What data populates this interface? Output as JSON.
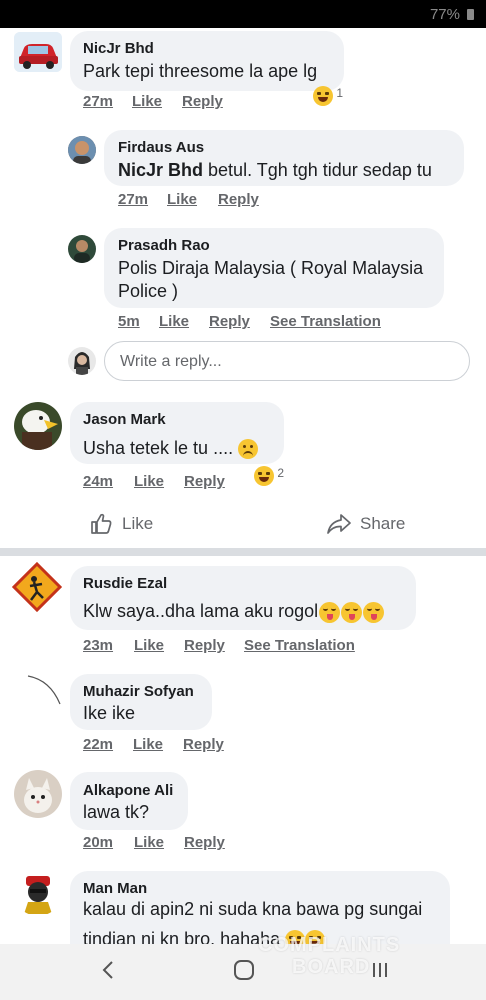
{
  "status_bar": {
    "battery": "77%"
  },
  "comments": [
    {
      "name": "NicJr Bhd",
      "text": "Park tepi threesome la ape lg",
      "time": "27m",
      "like": "Like",
      "reply": "Reply",
      "reaction_count": "1"
    },
    {
      "name": "Firdaus Aus",
      "mention": "NicJr Bhd",
      "text": " betul. Tgh tgh tidur sedap tu",
      "time": "27m",
      "like": "Like",
      "reply": "Reply"
    },
    {
      "name": "Prasadh Rao",
      "text_line1": "Polis Diraja Malaysia ( Royal Malaysia",
      "text_line2": "Police )",
      "time": "5m",
      "like": "Like",
      "reply": "Reply",
      "translate": "See Translation"
    },
    {
      "name": "Jason Mark",
      "text": "Usha tetek le tu .... ",
      "time": "24m",
      "like": "Like",
      "reply": "Reply",
      "reaction_count": "2"
    },
    {
      "name": "Rusdie Ezal",
      "text": "Klw saya..dha lama aku rogol",
      "time": "23m",
      "like": "Like",
      "reply": "Reply",
      "translate": "See Translation"
    },
    {
      "name": "Muhazir Sofyan",
      "text": "Ike ike",
      "time": "22m",
      "like": "Like",
      "reply": "Reply"
    },
    {
      "name": "Alkapone Ali",
      "text": "lawa  tk?",
      "time": "20m",
      "like": "Like",
      "reply": "Reply"
    },
    {
      "name": "Man Man",
      "text_line1": "kalau di apin2 ni suda kna bawa pg sungai",
      "text_line2": "tindian ni kn bro. hahaha "
    }
  ],
  "reply_box": {
    "placeholder": "Write a reply..."
  },
  "post_actions": {
    "like": "Like",
    "share": "Share"
  },
  "watermark": {
    "line1": "COMPLAINTS",
    "line2": "BOARD"
  }
}
